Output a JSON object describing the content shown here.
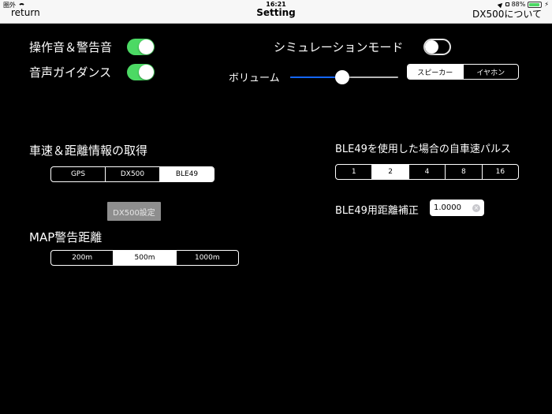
{
  "status_bar": {
    "carrier": "圏外",
    "time": "16:21",
    "battery_percent": "88%",
    "battery_level": 0.88
  },
  "nav": {
    "back_label": "return",
    "title": "Setting",
    "right_label": "DX500について"
  },
  "sound": {
    "operation_warning_label": "操作音＆警告音",
    "operation_warning_on": true,
    "voice_guidance_label": "音声ガイダンス",
    "voice_guidance_on": true
  },
  "simulation": {
    "label": "シミュレーションモード",
    "on": false
  },
  "volume": {
    "label": "ボリューム",
    "level": 0.48,
    "output_options": [
      "スピーカー",
      "イヤホン"
    ],
    "output_selected": 0
  },
  "speed_source": {
    "label": "車速＆距離情報の取得",
    "options": [
      "GPS",
      "DX500",
      "BLE49"
    ],
    "selected": 2,
    "dx500_button": "DX500設定"
  },
  "map_warning": {
    "label": "MAP警告距離",
    "options": [
      "200m",
      "500m",
      "1000m"
    ],
    "selected": 1
  },
  "ble_pulse": {
    "label": "BLE49を使用した場合の自車速パルス",
    "options": [
      "1",
      "2",
      "4",
      "8",
      "16"
    ],
    "selected": 1
  },
  "ble_distance": {
    "label": "BLE49用距離補正",
    "value": "1.0000"
  },
  "colors": {
    "toggle_on": "#4cd964",
    "slider_fill": "#1466ff",
    "background": "#000000"
  }
}
